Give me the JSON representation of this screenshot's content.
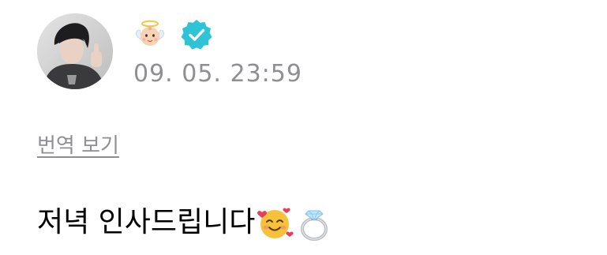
{
  "post": {
    "author_emoji": "baby-angel-emoji",
    "verified_color": "#2ec4d6",
    "timestamp": "09. 05. 23:59",
    "translate_label": "번역 보기",
    "body_text": "저녁 인사드립니다",
    "body_emojis": [
      "smiling-face-with-hearts-emoji",
      "ring-emoji"
    ]
  },
  "colors": {
    "muted_text": "#8e8e93",
    "body_text": "#000000",
    "background": "#ffffff"
  }
}
